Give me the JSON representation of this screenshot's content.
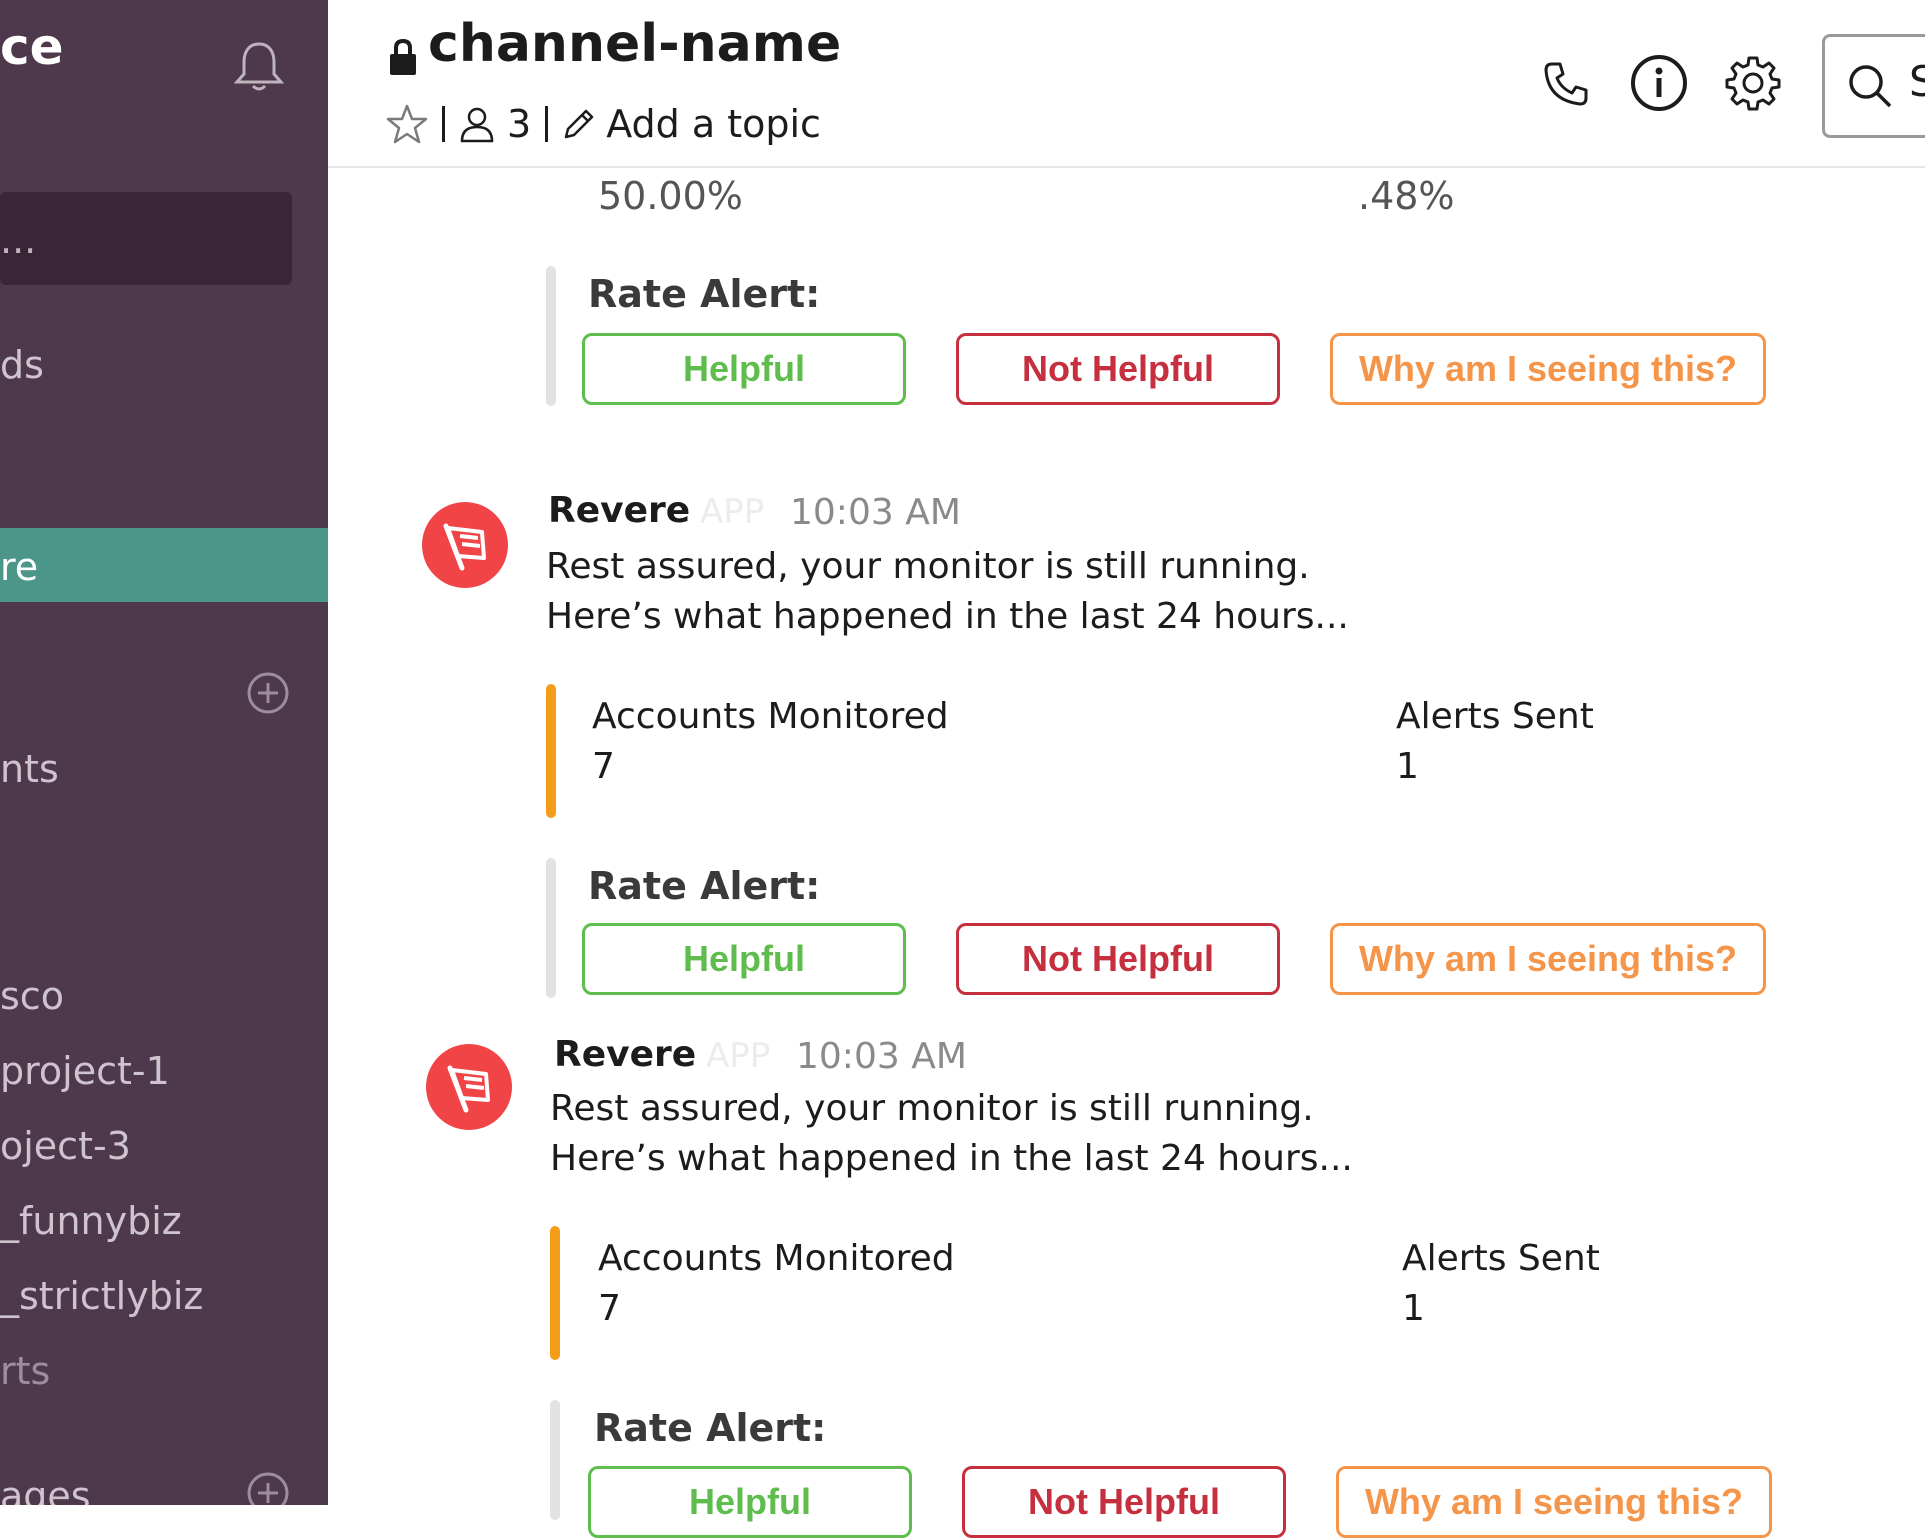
{
  "sidebar": {
    "workspace_name": "ce",
    "jump_to": "...",
    "item_threads": "ds",
    "active_item": "re",
    "section_channels": "nts",
    "channels": [
      "sco",
      "project-1",
      "oject-3",
      "_funnybiz",
      "_strictlybiz",
      "rts"
    ],
    "section_dms": "ages"
  },
  "header": {
    "channel_name": "channel-name",
    "member_count": "3",
    "add_topic": "Add a topic",
    "search_placeholder": "S"
  },
  "top_partial": {
    "left_value": "50.00%",
    "right_value": ".48%"
  },
  "rate": {
    "label": "Rate Alert:",
    "helpful": "Helpful",
    "not_helpful": "Not Helpful",
    "why": "Why am I seeing this?"
  },
  "messages": [
    {
      "sender": "Revere",
      "app_tag": "APP",
      "time": "10:03 AM",
      "line1": "Rest assured, your monitor is still running.",
      "line2": "Here’s what happened in the last 24 hours...",
      "fields": [
        {
          "label": "Accounts Monitored",
          "value": "7"
        },
        {
          "label": "Alerts Sent",
          "value": "1"
        }
      ]
    },
    {
      "sender": "Revere",
      "app_tag": "APP",
      "time": "10:03 AM",
      "line1": "Rest assured, your monitor is still running.",
      "line2": "Here’s what happened in the last 24 hours...",
      "fields": [
        {
          "label": "Accounts Monitored",
          "value": "7"
        },
        {
          "label": "Alerts Sent",
          "value": "1"
        }
      ]
    }
  ],
  "colors": {
    "sidebar_bg": "#4d394b",
    "active_item": "#4c9689",
    "helpful": "#5fbd4d",
    "not_helpful": "#c62f3e",
    "why": "#f5954a",
    "attachment_orange": "#f59c1a",
    "avatar_red": "#f04447"
  }
}
